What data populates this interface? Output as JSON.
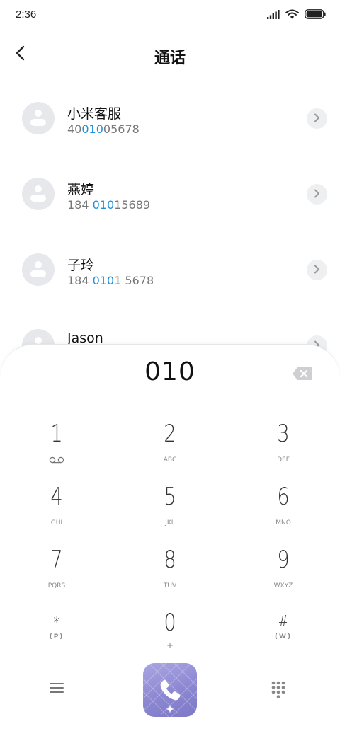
{
  "status_bar": {
    "time": "2:36"
  },
  "header": {
    "title": "通话"
  },
  "contacts": [
    {
      "name": "小米客服",
      "number_pre": "40",
      "number_match": "010",
      "number_post": "05678"
    },
    {
      "name": "燕婷",
      "number_pre": "184 ",
      "number_match": "010",
      "number_post": "15689"
    },
    {
      "name": "子玲",
      "number_pre": "184 ",
      "number_match": "010",
      "number_post": "1 5678"
    },
    {
      "name": "Jason"
    }
  ],
  "dialpad": {
    "input_value": "010",
    "keys": [
      {
        "digit": "1",
        "letters": ""
      },
      {
        "digit": "2",
        "letters": "ABC"
      },
      {
        "digit": "3",
        "letters": "DEF"
      },
      {
        "digit": "4",
        "letters": "GHI"
      },
      {
        "digit": "5",
        "letters": "JKL"
      },
      {
        "digit": "6",
        "letters": "MNO"
      },
      {
        "digit": "7",
        "letters": "PQRS"
      },
      {
        "digit": "8",
        "letters": "TUV"
      },
      {
        "digit": "9",
        "letters": "WXYZ"
      },
      {
        "digit": "*",
        "letters": "(P)"
      },
      {
        "digit": "0",
        "letters": "+"
      },
      {
        "digit": "#",
        "letters": "(W)"
      }
    ]
  },
  "colors": {
    "highlight": "#1e90d8",
    "call_button": "#8c87d1",
    "avatar_bg": "#e7e8ec"
  },
  "icons": {
    "back": "chevron-left-icon",
    "detail": "chevron-right-icon",
    "backspace": "backspace-icon",
    "voicemail": "voicemail-icon",
    "menu": "menu-icon",
    "call": "phone-icon",
    "keypad": "keypad-icon"
  }
}
